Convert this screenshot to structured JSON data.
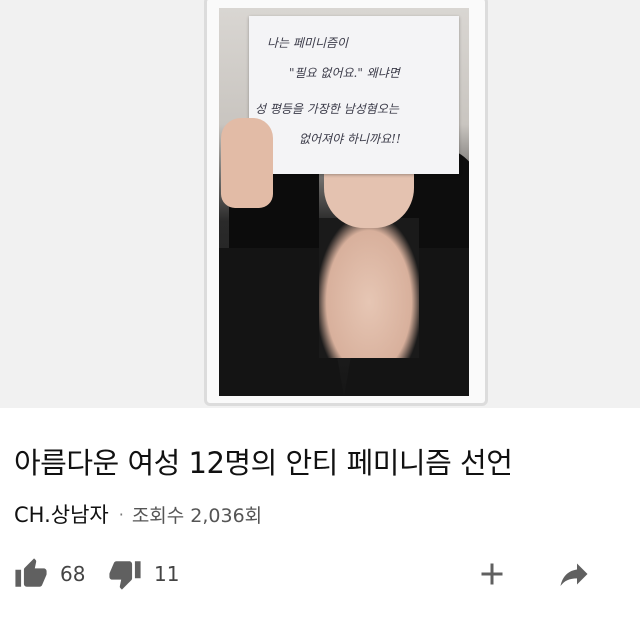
{
  "video": {
    "sign_lines": [
      "나는 페미니즘이",
      "\"필요 없어요.\" 왜냐면",
      "성 평등을 가장한 남성혐오는",
      "없어져야 하니까요!!"
    ]
  },
  "info": {
    "title": "아름다운 여성 12명의 안티 페미니즘 선언",
    "channel": "CH.상남자",
    "separator": "·",
    "views_label": "조회수",
    "views_count": "2,036회"
  },
  "actions": {
    "likes": "68",
    "dislikes": "11",
    "icons": {
      "like": "thumbs-up-icon",
      "dislike": "thumbs-down-icon",
      "add": "plus-icon",
      "share": "share-arrow-icon"
    },
    "icon_color": "#606060"
  }
}
